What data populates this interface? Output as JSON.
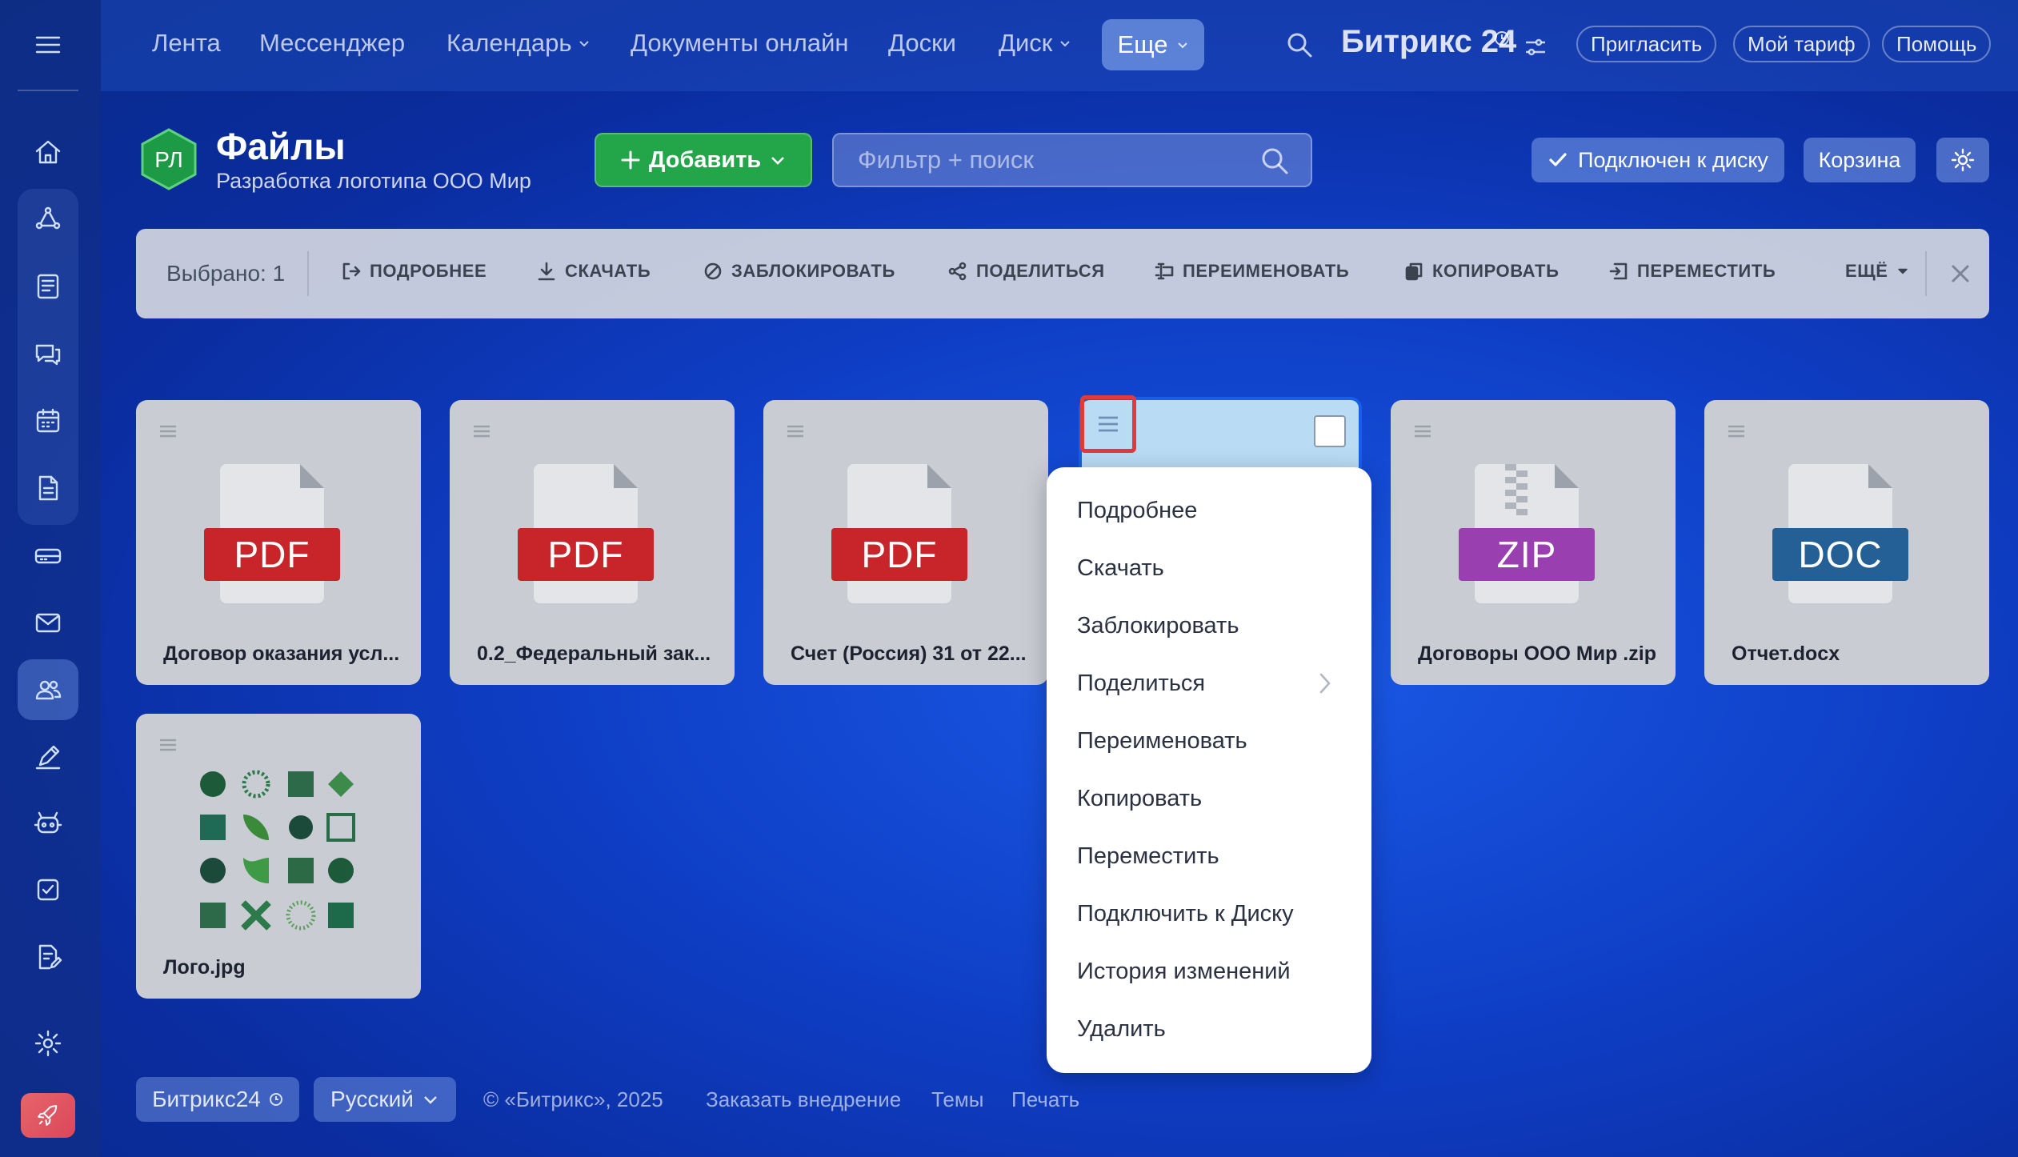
{
  "colors": {
    "accent": "#1560e6",
    "add_button": "#23a54a",
    "pdf_badge": "#c8252a",
    "zip_badge": "#9a3fb0",
    "doc_badge": "#245f96",
    "highlight_border": "#e23a3a"
  },
  "sidebar": {
    "items": [
      {
        "icon": "hamburger-icon"
      },
      {
        "icon": "home-icon"
      },
      {
        "icon": "crm-icon"
      },
      {
        "icon": "feed-icon"
      },
      {
        "icon": "chat-icon"
      },
      {
        "icon": "calendar-icon"
      },
      {
        "icon": "document-icon"
      },
      {
        "icon": "drive-icon"
      },
      {
        "icon": "mail-icon"
      },
      {
        "icon": "employees-icon"
      },
      {
        "icon": "sign-icon"
      },
      {
        "icon": "robot-icon"
      },
      {
        "icon": "tasks-icon"
      },
      {
        "icon": "forms-icon"
      },
      {
        "icon": "settings-icon"
      },
      {
        "icon": "rocket-icon"
      }
    ]
  },
  "topnav": {
    "items": [
      {
        "label": "Лента"
      },
      {
        "label": "Мессенджер"
      },
      {
        "label": "Календарь"
      },
      {
        "label": "Документы онлайн"
      },
      {
        "label": "Доски"
      },
      {
        "label": "Диск"
      }
    ],
    "more_label": "Еще",
    "brand": "Битрикс 24",
    "invite": "Пригласить",
    "tariff": "Мой тариф",
    "help": "Помощь"
  },
  "header": {
    "avatar_initials": "РЛ",
    "title": "Файлы",
    "subtitle": "Разработка логотипа ООО Мир",
    "add_label": "Добавить",
    "search_placeholder": "Фильтр + поиск",
    "connected_label": "Подключен к диску",
    "trash_label": "Корзина"
  },
  "toolbar": {
    "selected": "Выбрано: 1",
    "actions": [
      {
        "label": "ПОДРОБНЕЕ"
      },
      {
        "label": "СКАЧАТЬ"
      },
      {
        "label": "ЗАБЛОКИРОВАТЬ"
      },
      {
        "label": "ПОДЕЛИТЬСЯ"
      },
      {
        "label": "ПЕРЕИМЕНОВАТЬ"
      },
      {
        "label": "КОПИРОВАТЬ"
      },
      {
        "label": "ПЕРЕМЕСТИТЬ"
      }
    ],
    "more": "ЕЩЁ"
  },
  "files": [
    {
      "name": "Договор оказания усл...",
      "type": "PDF"
    },
    {
      "name": "0.2_Федеральный зак...",
      "type": "PDF"
    },
    {
      "name": "Счет (Россия) 31 от 22...",
      "type": "PDF"
    },
    {
      "name": "",
      "type": "selected"
    },
    {
      "name": "Договоры ООО Мир .zip",
      "type": "ZIP"
    },
    {
      "name": "Отчет.docx",
      "type": "DOC"
    },
    {
      "name": "Лого.jpg",
      "type": "image"
    }
  ],
  "context_menu": {
    "items": [
      {
        "label": "Подробнее"
      },
      {
        "label": "Скачать"
      },
      {
        "label": "Заблокировать"
      },
      {
        "label": "Поделиться"
      },
      {
        "label": "Переименовать"
      },
      {
        "label": "Копировать"
      },
      {
        "label": "Переместить"
      },
      {
        "label": "Подключить к Диску"
      },
      {
        "label": "История изменений"
      },
      {
        "label": "Удалить"
      }
    ]
  },
  "footer": {
    "brand": "Битрикс24",
    "language": "Русский",
    "copyright": "© «Битрикс», 2025",
    "order": "Заказать внедрение",
    "themes": "Темы",
    "print": "Печать"
  }
}
